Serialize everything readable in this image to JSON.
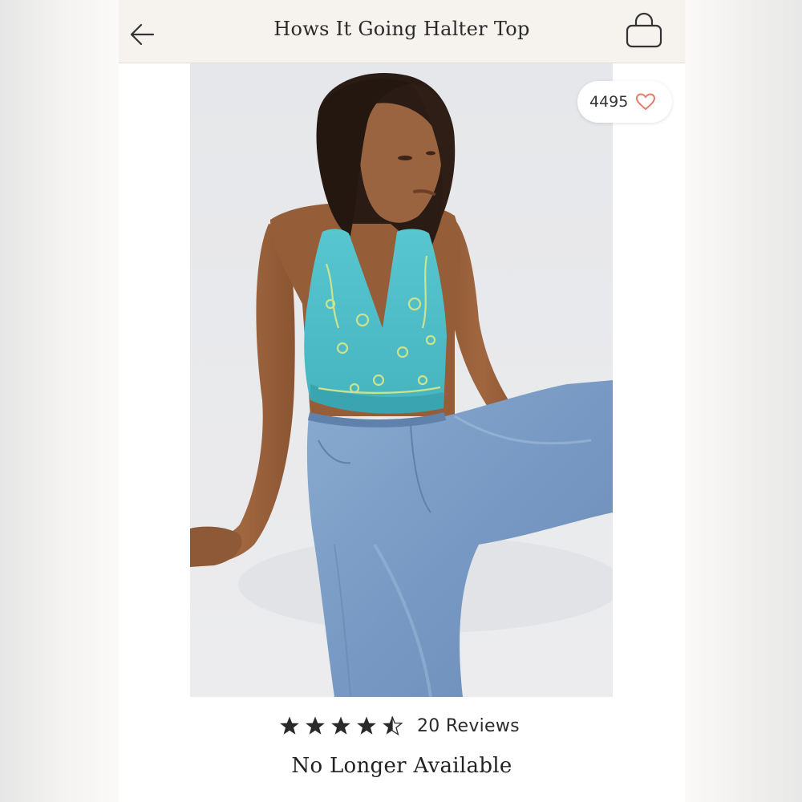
{
  "header": {
    "title": "Hows It Going Halter Top",
    "back_icon": "arrow-left-icon",
    "bag_icon": "shopping-bag-icon"
  },
  "product_image": {
    "description_icon": "product-photo"
  },
  "favorites": {
    "count": "4495",
    "icon": "heart-outline-icon",
    "heart_color": "#e77c6d"
  },
  "rating": {
    "stars": 4.5,
    "reviews_label": "20 Reviews"
  },
  "availability": {
    "status": "No Longer Available"
  },
  "colors": {
    "header_bg": "#f6f3ef",
    "star": "#2a2a2a",
    "top_fabric": "#4fc0c9",
    "jeans": "#7fa2c9"
  }
}
